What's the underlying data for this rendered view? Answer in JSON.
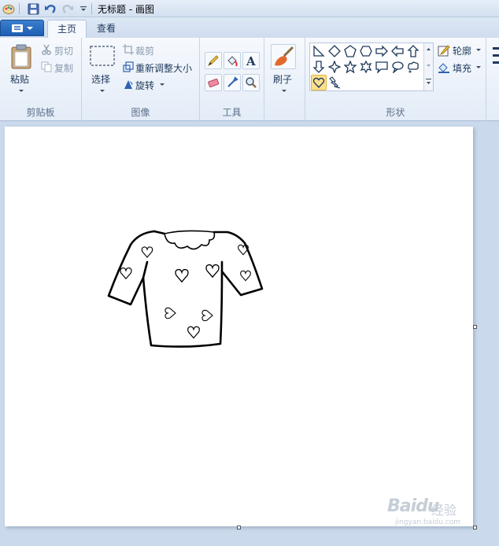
{
  "window": {
    "title": "无标题 - 画图"
  },
  "quick_access": [
    {
      "name": "paint-app-icon"
    },
    {
      "name": "save-icon"
    },
    {
      "name": "undo-icon"
    },
    {
      "name": "redo-icon"
    },
    {
      "name": "customize-dropdown-icon"
    }
  ],
  "tabs": [
    {
      "label": "主页",
      "active": true
    },
    {
      "label": "查看",
      "active": false
    }
  ],
  "groups": {
    "clipboard": {
      "label": "剪贴板",
      "paste": "粘贴",
      "cut": "剪切",
      "copy": "复制"
    },
    "image": {
      "label": "图像",
      "select": "选择",
      "crop": "裁剪",
      "resize": "重新调整大小",
      "rotate": "旋转"
    },
    "tools": {
      "label": "工具",
      "items": [
        "pencil-icon",
        "fill-icon",
        "text-icon",
        "eraser-icon",
        "color-picker-icon",
        "magnifier-icon"
      ]
    },
    "brushes": {
      "label": "刷子"
    },
    "shapes": {
      "label": "形状",
      "outline": "轮廓",
      "fill": "填充",
      "selected": "heart"
    }
  },
  "accent_colors": {
    "file_button": "#1c5fb4",
    "selected_shape": "#fddf8c",
    "workspace": "#cad9eb"
  },
  "watermark": {
    "logo": "Baidu",
    "sub": "经验",
    "url": "jingyan.baidu.com"
  }
}
